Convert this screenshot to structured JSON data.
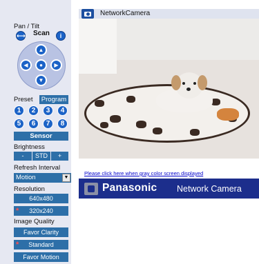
{
  "header": {
    "title": "NetworkCamera"
  },
  "sidebar": {
    "pan_tilt_label": "Pan / Tilt",
    "scan_label": "Scan",
    "scan_left": "⟷",
    "scan_info": "i",
    "pad": {
      "up": "▲",
      "down": "▼",
      "left": "◀",
      "right": "▶",
      "home": "●"
    },
    "preset_label": "Preset",
    "program_label": "Program",
    "presets": [
      "1",
      "2",
      "3",
      "4",
      "5",
      "6",
      "7",
      "8"
    ],
    "sensor_label": "Sensor",
    "brightness_label": "Brightness",
    "brightness": {
      "minus": "-",
      "std": "STD",
      "plus": "+"
    },
    "refresh_label": "Refresh Interval",
    "refresh_value": "Motion",
    "resolution_label": "Resolution",
    "resolutions": [
      {
        "label": "640x480",
        "selected": false
      },
      {
        "label": "320x240",
        "selected": true
      }
    ],
    "quality_label": "Image Quality",
    "qualities": [
      {
        "label": "Favor Clarity",
        "selected": false
      },
      {
        "label": "Standard",
        "selected": true
      },
      {
        "label": "Favor Motion",
        "selected": false
      }
    ],
    "selected_marker": "*"
  },
  "link_text": "Please click here when gray color screen displayed",
  "banner": {
    "brand": "Panasonic",
    "product": "Network Camera"
  },
  "colors": {
    "sidebar_bg": "#e6e8f2",
    "button_blue": "#2d6fa8",
    "round_blue": "#1c63c7",
    "banner_bg": "#1c2e8c",
    "link": "#0000cc"
  },
  "icons": [
    "camera-icon",
    "scan-left-icon",
    "info-icon",
    "arrow-up-icon",
    "arrow-down-icon",
    "arrow-left-icon",
    "arrow-right-icon",
    "home-icon",
    "dropdown-arrow-icon",
    "panasonic-logo-icon"
  ]
}
